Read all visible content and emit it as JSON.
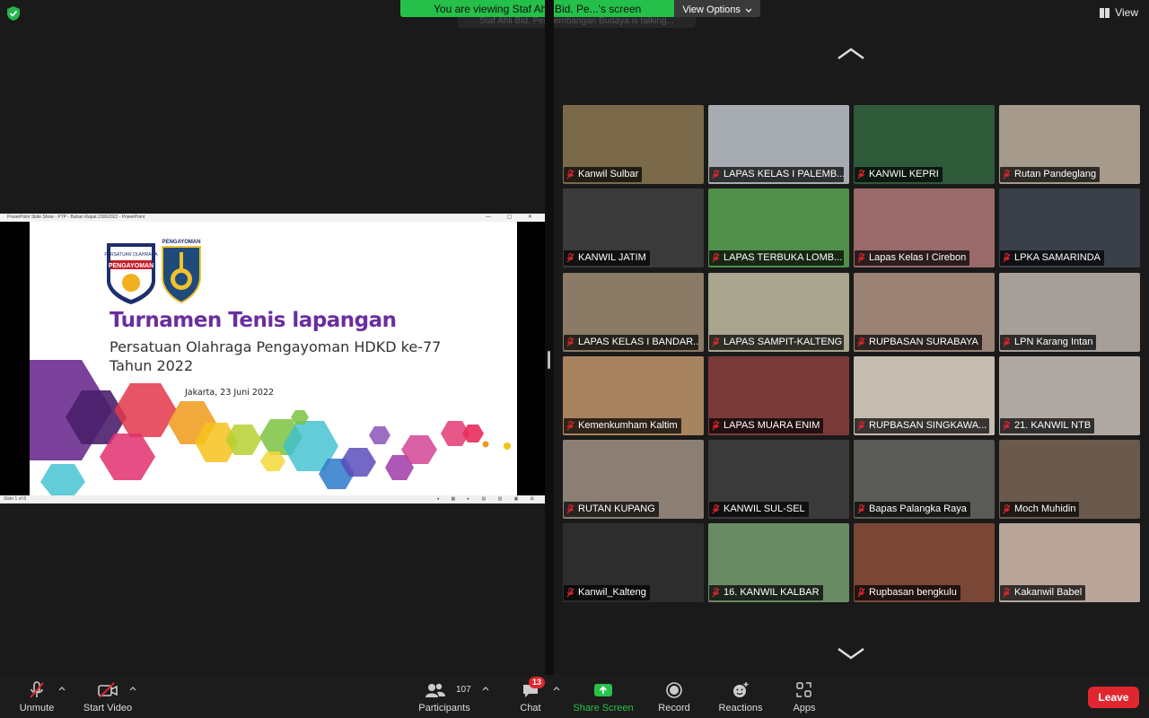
{
  "banner": {
    "message": "You are viewing Staf Ahli Bid. Pe...'s screen",
    "view_options": "View Options",
    "talking": "Staf Ahli Bid. Pengembangan Budaya is talking..."
  },
  "view_button": "View",
  "shared_screen": {
    "window_title": "PowerPoint Slide Show  -  PTP - Bahan Rapat 23062022 - PowerPoint",
    "logo_label": "PENGAYOMAN",
    "slide_title": "Turnamen Tenis lapangan",
    "slide_subtitle_1": "Persatuan Olahraga Pengayoman HDKD ke-77",
    "slide_subtitle_2": "Tahun 2022",
    "slide_date": "Jakarta, 23 Juni 2022",
    "status_left": "Slide 1 of 8"
  },
  "participants": [
    {
      "name": "Kanwil Sulbar",
      "color": "#7a6a4a"
    },
    {
      "name": "LAPAS KELAS I PALEMB...",
      "color": "#a7acb2"
    },
    {
      "name": "KANWIL KEPRI",
      "color": "#2f5a3a"
    },
    {
      "name": "Rutan Pandeglang",
      "color": "#a69a8c"
    },
    {
      "name": "KANWIL JATIM",
      "color": "#3a3a3a"
    },
    {
      "name": "LAPAS TERBUKA LOMB...",
      "color": "#4f8f4a"
    },
    {
      "name": "Lapas Kelas I Cirebon",
      "color": "#9a6a6a"
    },
    {
      "name": "LPKA SAMARINDA",
      "color": "#3a3f4a"
    },
    {
      "name": "LAPAS KELAS I BANDAR...",
      "color": "#8a7a66"
    },
    {
      "name": "LAPAS SAMPIT-KALTENG",
      "color": "#a9a58e"
    },
    {
      "name": "RUPBASAN SURABAYA",
      "color": "#9a8275"
    },
    {
      "name": "LPN Karang Intan",
      "color": "#a69e98"
    },
    {
      "name": "Kemenkumham Kaltim",
      "color": "#a8835f"
    },
    {
      "name": "LAPAS MUARA ENIM",
      "color": "#7a3a3a"
    },
    {
      "name": "RUPBASAN SINGKAWA...",
      "color": "#c4bcb0"
    },
    {
      "name": "21. KANWIL NTB",
      "color": "#b0a8a2"
    },
    {
      "name": "RUTAN KUPANG",
      "color": "#8b7f74"
    },
    {
      "name": "KANWIL SUL-SEL",
      "color": "#3a3a3a"
    },
    {
      "name": "Bapas Palangka Raya",
      "color": "#5a5a56"
    },
    {
      "name": "Moch Muhidin",
      "color": "#6a5a4e"
    },
    {
      "name": "Kanwil_Kalteng",
      "color": "#2d2d2d"
    },
    {
      "name": "16. KANWIL KALBAR",
      "color": "#6a8a66"
    },
    {
      "name": "Rupbasan bengkulu",
      "color": "#7a4636"
    },
    {
      "name": "Kakanwil Babel",
      "color": "#b9a59a"
    }
  ],
  "toolbar": {
    "unmute": "Unmute",
    "start_video": "Start Video",
    "participants": "Participants",
    "participant_count": "107",
    "chat": "Chat",
    "chat_badge": "13",
    "share_screen": "Share Screen",
    "record": "Record",
    "reactions": "Reactions",
    "apps": "Apps",
    "leave": "Leave"
  }
}
